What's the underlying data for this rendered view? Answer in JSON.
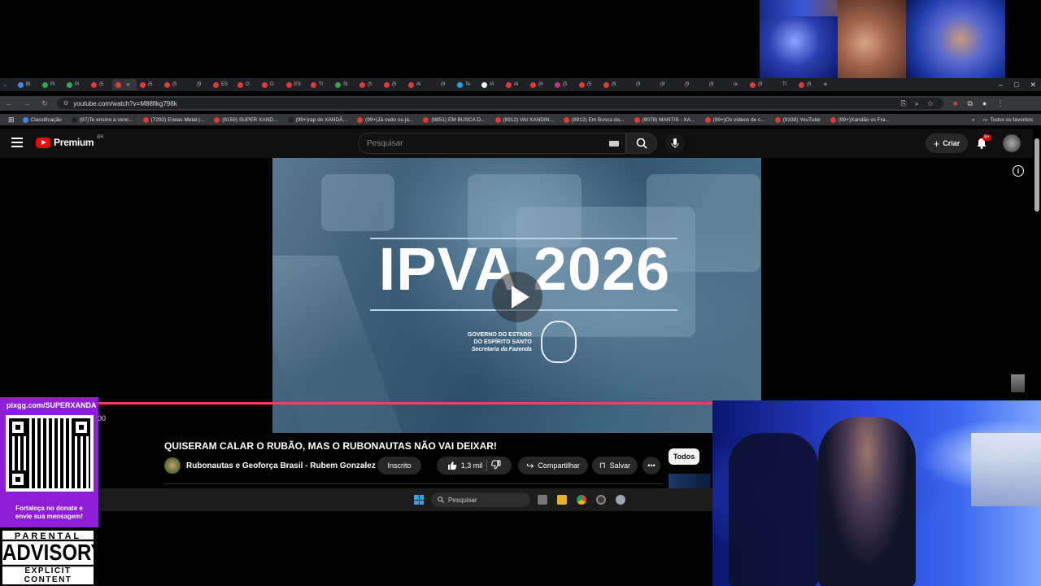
{
  "browser": {
    "url": "youtube.com/watch?v=M88fikg798k",
    "tabs": [
      "Bi",
      "Pi",
      "Pi",
      "(5",
      "",
      "(5",
      "(5",
      "(9",
      "ES",
      "O",
      "O",
      "ES",
      "Tr",
      "St",
      "(5",
      "(5",
      "Al",
      "(9",
      "Te",
      "Vi",
      "Al",
      "(9",
      "(5",
      "(5",
      "(9",
      "(9",
      "(9",
      "(9",
      "(9",
      "ia",
      "(9",
      "Tl",
      "(9"
    ],
    "window_controls": [
      "–",
      "□",
      "✕"
    ],
    "bookmarks": [
      "Classificação",
      "(97)Te ensino a venc...",
      "(7292) Enéas Metal |...",
      "(8159) SUPER XAND...",
      "(99+)rap do XANDÃ...",
      "(99+)Já cedo ou já...",
      "(8851) EM BUSCA D...",
      "(8912) VAI XANDIN...",
      "(8912) Em Busca da...",
      "(9078) MANTIS - XA...",
      "(99+)Os vídeos de c...",
      "(9338) YouTube",
      "(99+)Xandão vs Fra..."
    ],
    "all_favorites": "Todos os favoritos"
  },
  "youtube": {
    "logo_text": "Premium",
    "logo_region": "BR",
    "search_placeholder": "Pesquisar",
    "create_label": "Criar",
    "notif_badge": "9+"
  },
  "video": {
    "thumbnail_title": "IPVA 2026",
    "gov_line1": "GOVERNO DO ESTADO",
    "gov_line2": "DO ESPÍRITO SANTO",
    "gov_line3": "Secretaria da Fazenda",
    "time_fragment": "00",
    "title": "QUISERAM CALAR O RUBÃO, MAS O RUBONAUTAS NÃO VAI DEIXAR!",
    "channel": "Rubonautas e Geoforça Brasil - Rubem Gonzalez",
    "subscribed_label": "Inscrito",
    "likes": "1,3 mil",
    "share_label": "Compartilhar",
    "save_label": "Salvar",
    "filter_all": "Todos"
  },
  "taskbar": {
    "search_label": "Pesquisar"
  },
  "overlay": {
    "donate_url": "pixgg.com/SUPERXANDA",
    "donate_message_1": "Fortaleça no donate e",
    "donate_message_2": "envie sua mensagem!",
    "parental_top": "PARENTAL",
    "parental_mid": "ADVISORY",
    "parental_bot": "EXPLICIT CONTENT"
  },
  "colors": {
    "youtube_red": "#ff0000",
    "progress": "#e8455c",
    "donate_bg": "#8e1dd6"
  }
}
